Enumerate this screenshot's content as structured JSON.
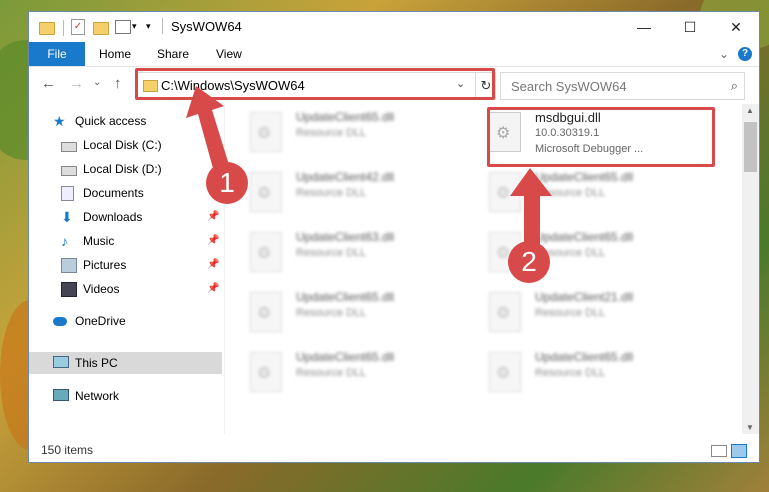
{
  "window": {
    "title": "SysWOW64",
    "minimize_glyph": "—",
    "maximize_glyph": "☐",
    "close_glyph": "✕"
  },
  "ribbon": {
    "tabs": [
      "File",
      "Home",
      "Share",
      "View"
    ],
    "collapse_glyph": "⌄",
    "help_glyph": "?"
  },
  "nav": {
    "back_glyph": "←",
    "forward_glyph": "→",
    "recent_glyph": "⌄",
    "up_glyph": "↑"
  },
  "address": {
    "path": "C:\\Windows\\SysWOW64",
    "dropdown_glyph": "⌄",
    "refresh_glyph": "↻"
  },
  "search": {
    "placeholder": "Search SysWOW64",
    "icon": "search-icon",
    "icon_glyph": "⌕"
  },
  "sidebar": {
    "items": [
      {
        "label": "Quick access",
        "icon": "star-icon",
        "pinned": false
      },
      {
        "label": "Local Disk (C:)",
        "icon": "drive-icon",
        "pinned": false
      },
      {
        "label": "Local Disk (D:)",
        "icon": "drive-icon",
        "pinned": false
      },
      {
        "label": "Documents",
        "icon": "documents-icon",
        "pinned": false
      },
      {
        "label": "Downloads",
        "icon": "download-icon",
        "pinned": true
      },
      {
        "label": "Music",
        "icon": "music-icon",
        "pinned": true
      },
      {
        "label": "Pictures",
        "icon": "pictures-icon",
        "pinned": true
      },
      {
        "label": "Videos",
        "icon": "videos-icon",
        "pinned": true
      },
      {
        "label": "OneDrive",
        "icon": "cloud-icon",
        "pinned": false
      },
      {
        "label": "This PC",
        "icon": "computer-icon",
        "pinned": false,
        "selected": true
      },
      {
        "label": "Network",
        "icon": "network-icon",
        "pinned": false
      }
    ],
    "pin_glyph": "📌"
  },
  "files": {
    "left": [
      {
        "name": "UpdateClient65.dll",
        "type": "Resource DLL"
      },
      {
        "name": "UpdateClient42.dll",
        "type": "Resource DLL"
      },
      {
        "name": "UpdateClient63.dll",
        "type": "Resource DLL"
      },
      {
        "name": "UpdateClient65.dll",
        "type": "Resource DLL"
      },
      {
        "name": "UpdateClient65.dll",
        "type": "Resource DLL"
      }
    ],
    "right": [
      {
        "name": "msdbgui.dll",
        "version": "10.0.30319.1",
        "type": "Microsoft Debugger ..."
      },
      {
        "name": "UpdateClient65.dll",
        "type": "Resource DLL"
      },
      {
        "name": "UpdateClient65.dll",
        "type": "Resource DLL"
      },
      {
        "name": "UpdateClient21.dll",
        "type": "Resource DLL"
      },
      {
        "name": "UpdateClient65.dll",
        "type": "Resource DLL"
      }
    ]
  },
  "status": {
    "item_count": "150 items"
  },
  "callouts": {
    "one": "1",
    "two": "2"
  },
  "colors": {
    "accent": "#1979ca",
    "highlight": "#d84a4a",
    "selected": "#d9d9d9"
  }
}
